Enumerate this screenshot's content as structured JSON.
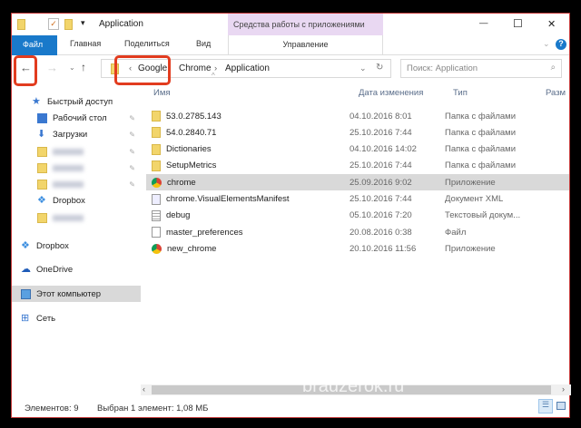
{
  "window": {
    "title": "Application",
    "context_group": "Средства работы с приложениями",
    "controls": {
      "minimize": "—",
      "maximize": "☐",
      "close": "✕"
    }
  },
  "ribbon": {
    "tabs": [
      "Файл",
      "Главная",
      "Поделиться",
      "Вид"
    ],
    "context_tab": "Управление"
  },
  "address": {
    "path": [
      "Google",
      "Chrome",
      "Application"
    ],
    "overflow": "‹",
    "sep": "›"
  },
  "search": {
    "placeholder": "Поиск: Application"
  },
  "sidebar": {
    "items": [
      {
        "label": "Быстрый доступ",
        "icon": "star-icon"
      },
      {
        "label": "Рабочий стол",
        "icon": "desktop-icon",
        "pinned": true
      },
      {
        "label": "Загрузки",
        "icon": "download-icon",
        "pinned": true
      },
      {
        "label": "",
        "icon": "folder-icon",
        "pinned": true,
        "blurred": true
      },
      {
        "label": "",
        "icon": "folder-icon",
        "pinned": true,
        "blurred": true
      },
      {
        "label": "",
        "icon": "folder-icon",
        "pinned": true,
        "blurred": true
      },
      {
        "label": "Dropbox",
        "icon": "dropbox-icon"
      },
      {
        "label": "",
        "icon": "folder-icon",
        "blurred": true
      },
      {
        "label": "Dropbox",
        "icon": "dropbox-icon"
      },
      {
        "label": "OneDrive",
        "icon": "onedrive-icon"
      },
      {
        "label": "Этот компьютер",
        "icon": "computer-icon",
        "selected": true
      },
      {
        "label": "Сеть",
        "icon": "network-icon"
      }
    ]
  },
  "columns": {
    "name": "Имя",
    "date": "Дата изменения",
    "type": "Тип",
    "size": "Разм"
  },
  "files": [
    {
      "name": "53.0.2785.143",
      "date": "04.10.2016 8:01",
      "type": "Папка с файлами",
      "icon": "folder"
    },
    {
      "name": "54.0.2840.71",
      "date": "25.10.2016 7:44",
      "type": "Папка с файлами",
      "icon": "folder"
    },
    {
      "name": "Dictionaries",
      "date": "04.10.2016 14:02",
      "type": "Папка с файлами",
      "icon": "folder"
    },
    {
      "name": "SetupMetrics",
      "date": "25.10.2016 7:44",
      "type": "Папка с файлами",
      "icon": "folder"
    },
    {
      "name": "chrome",
      "date": "25.09.2016 9:02",
      "type": "Приложение",
      "icon": "chrome",
      "selected": true
    },
    {
      "name": "chrome.VisualElementsManifest",
      "date": "25.10.2016 7:44",
      "type": "Документ XML",
      "icon": "xml"
    },
    {
      "name": "debug",
      "date": "05.10.2016 7:20",
      "type": "Текстовый докум...",
      "icon": "text"
    },
    {
      "name": "master_preferences",
      "date": "20.08.2016 0:38",
      "type": "Файл",
      "icon": "file"
    },
    {
      "name": "new_chrome",
      "date": "20.10.2016 11:56",
      "type": "Приложение",
      "icon": "chrome"
    }
  ],
  "status": {
    "count": "Элементов: 9",
    "selection": "Выбран 1 элемент: 1,08 МБ"
  },
  "watermark": "brauzerok.ru",
  "colors": {
    "accent": "#1979ca",
    "highlight": "#e23c1f",
    "context": "#e9d8f2"
  }
}
